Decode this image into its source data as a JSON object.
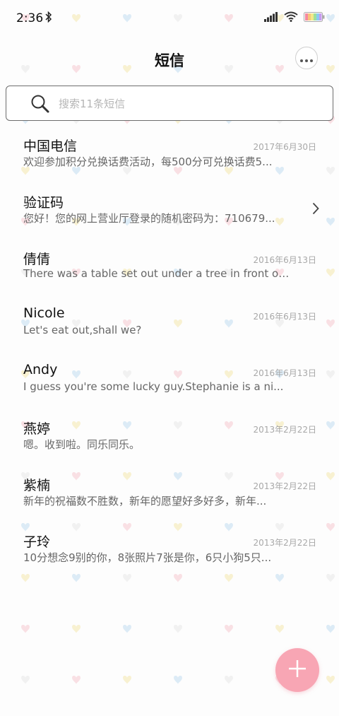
{
  "status_bar": {
    "time": "2:36"
  },
  "header": {
    "title": "短信"
  },
  "search": {
    "placeholder": "搜索11条短信"
  },
  "messages": [
    {
      "name": "中国电信",
      "date": "2017年6月30日",
      "preview": "欢迎参加积分兑换话费活动，每500分可兑换话费5..."
    },
    {
      "name": "验证码",
      "date": "",
      "preview": "您好！您的网上营业厅登录的随机密码为：710679..."
    },
    {
      "name": "倩倩",
      "date": "2016年6月13日",
      "preview": "There was a table set out under a tree in front of ..."
    },
    {
      "name": "Nicole",
      "date": "2016年6月13日",
      "preview": "Let's eat out,shall we?"
    },
    {
      "name": "Andy",
      "date": "2016年6月13日",
      "preview": "I guess you're some lucky guy.Stephanie is a ni..."
    },
    {
      "name": "燕婷",
      "date": "2013年2月22日",
      "preview": "嗯。收到啦。同乐同乐。"
    },
    {
      "name": "紫楠",
      "date": "2013年2月22日",
      "preview": "新年的祝福数不胜数，新年的愿望好多好多，新年..."
    },
    {
      "name": "子玲",
      "date": "2013年2月22日",
      "preview": "10分想念9别的你，8张照片7张是你，6只小狗5只..."
    }
  ],
  "colors": {
    "fab": "#f8a6b4",
    "accent_hearts": [
      "#f6c3cc",
      "#f3e6a6",
      "#bcd9ef",
      "#e5e5e5"
    ]
  },
  "icons": [
    "bluetooth-icon",
    "signal-icon",
    "wifi-icon",
    "battery-icon",
    "more-icon",
    "search-icon",
    "chevron-right-icon",
    "plus-icon"
  ]
}
